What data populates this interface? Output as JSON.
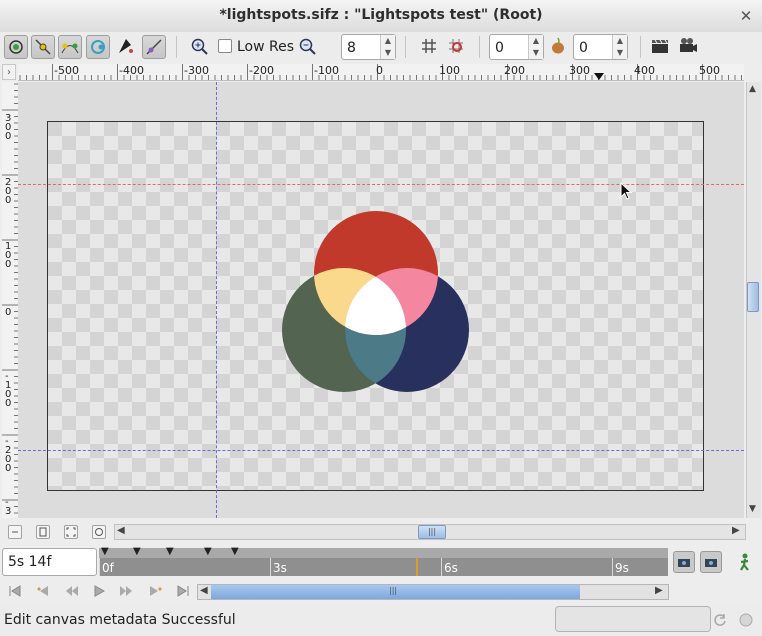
{
  "window": {
    "title": "*lightspots.sifz : \"Lightspots test\" (Root)",
    "close_glyph": "✕"
  },
  "toolbar": {
    "low_res_label": "Low Res",
    "low_res_checked": false,
    "zoom_value": "8",
    "onion_past": "0",
    "onion_future": "0",
    "icons": [
      "render-mode-icon",
      "draw-vertex-icon",
      "draw-tangent-icon",
      "draw-ducks-icon",
      "bline-icon",
      "width-icon",
      "zoom-in-icon",
      "zoom-out-icon",
      "grid-icon",
      "snap-icon",
      "onion-skin-icon",
      "render-icon",
      "preview-icon"
    ]
  },
  "ruler": {
    "corner": "›",
    "h_labels": [
      "-500",
      "-400",
      "-300",
      "-200",
      "-100",
      "0",
      "100",
      "200",
      "300",
      "400",
      "500"
    ],
    "v_labels": [
      "300",
      "200",
      "100",
      "0",
      "-100",
      "-200",
      "-3"
    ]
  },
  "time": {
    "current": "5s 14f",
    "labels": [
      "0f",
      "3s",
      "6s",
      "9s"
    ]
  },
  "colors": {
    "red": "#c0392b",
    "pink": "#f4879f",
    "yellow": "#fbd98c",
    "green": "#536451",
    "navy": "#28305e",
    "teal": "#4d7a87",
    "white": "#ffffff"
  },
  "status": {
    "message": "Edit canvas metadata Successful"
  }
}
